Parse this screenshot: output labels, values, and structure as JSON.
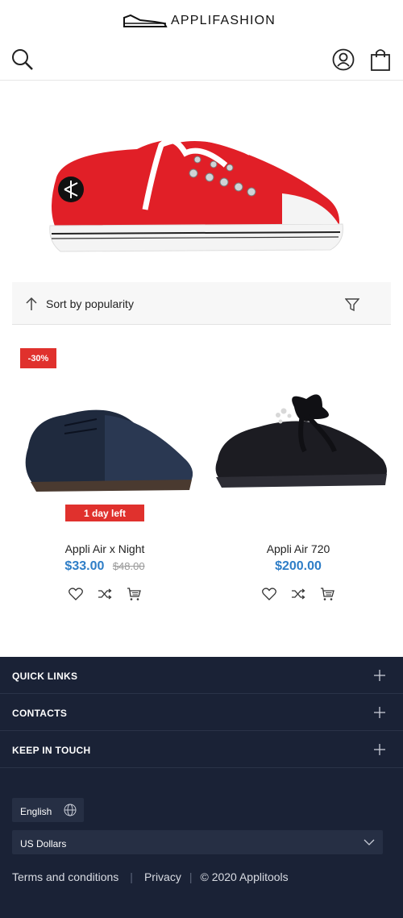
{
  "header": {
    "logo_text": "APPLIFASHION"
  },
  "icons": {
    "search": "search-icon",
    "user": "user-icon",
    "bag": "shopping-bag-icon",
    "sort": "sort-up-arrow-icon",
    "filter": "filter-funnel-icon",
    "wishlist": "heart-icon",
    "compare": "shuffle-icon",
    "cart": "cart-icon",
    "plus": "plus-icon",
    "globe": "globe-icon",
    "chevron": "chevron-down-icon"
  },
  "toolbar": {
    "sort_label": "Sort by popularity"
  },
  "products": [
    {
      "name": "Appli Air x Night",
      "price": "$33.00",
      "old_price": "$48.00",
      "sale_badge": "-30%",
      "countdown_badge": "1 day left"
    },
    {
      "name": "Appli Air 720",
      "price": "$200.00"
    }
  ],
  "footer": {
    "sections": [
      "QUICK LINKS",
      "CONTACTS",
      "KEEP IN TOUCH"
    ],
    "language": "English",
    "currency": "US Dollars",
    "links": {
      "terms": "Terms and conditions",
      "privacy": "Privacy",
      "copyright": "© 2020 Applitools"
    }
  },
  "colors": {
    "accent_price": "#2f7ec7",
    "badge_red": "#e0312d",
    "footer_bg": "#1a2236"
  }
}
